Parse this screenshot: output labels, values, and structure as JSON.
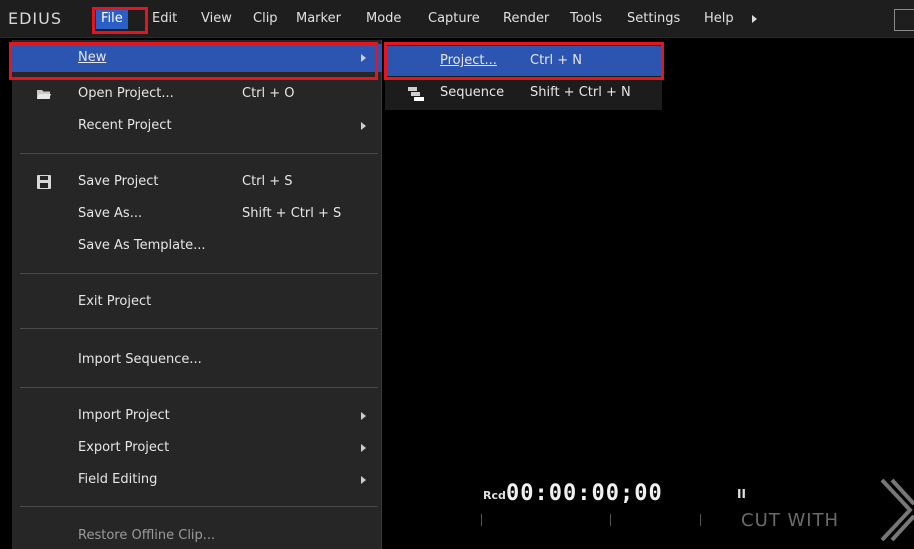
{
  "app": {
    "logo": "EDIUS"
  },
  "menubar": {
    "items": [
      "File",
      "Edit",
      "View",
      "Clip",
      "Marker",
      "Mode",
      "Capture",
      "Render",
      "Tools",
      "Settings",
      "Help"
    ]
  },
  "file_menu": {
    "new": {
      "label": "New"
    },
    "open_project": {
      "label": "Open Project...",
      "accel": "Ctrl + O"
    },
    "recent_project": {
      "label": "Recent Project"
    },
    "save_project": {
      "label": "Save Project",
      "accel": "Ctrl + S"
    },
    "save_as": {
      "label": "Save As...",
      "accel": "Shift + Ctrl + S"
    },
    "save_as_template": {
      "label": "Save As Template..."
    },
    "exit_project": {
      "label": "Exit Project"
    },
    "import_sequence": {
      "label": "Import Sequence..."
    },
    "import_project": {
      "label": "Import Project"
    },
    "export_project": {
      "label": "Export Project"
    },
    "field_editing": {
      "label": "Field Editing"
    },
    "restore_offline_clip": {
      "label": "Restore Offline Clip..."
    }
  },
  "new_submenu": {
    "project": {
      "label": "Project...",
      "accel": "Ctrl + N"
    },
    "sequence": {
      "label": "Sequence",
      "accel": "Shift + Ctrl + N"
    }
  },
  "player": {
    "rcd_label": "Rcd",
    "timecode": "00:00:00;00",
    "pause_symbol": "II",
    "overlay_text": "CUT WITH"
  },
  "colors": {
    "highlight": "#e3151e",
    "selection": "#2b55b0",
    "menu_bg": "#262626"
  }
}
